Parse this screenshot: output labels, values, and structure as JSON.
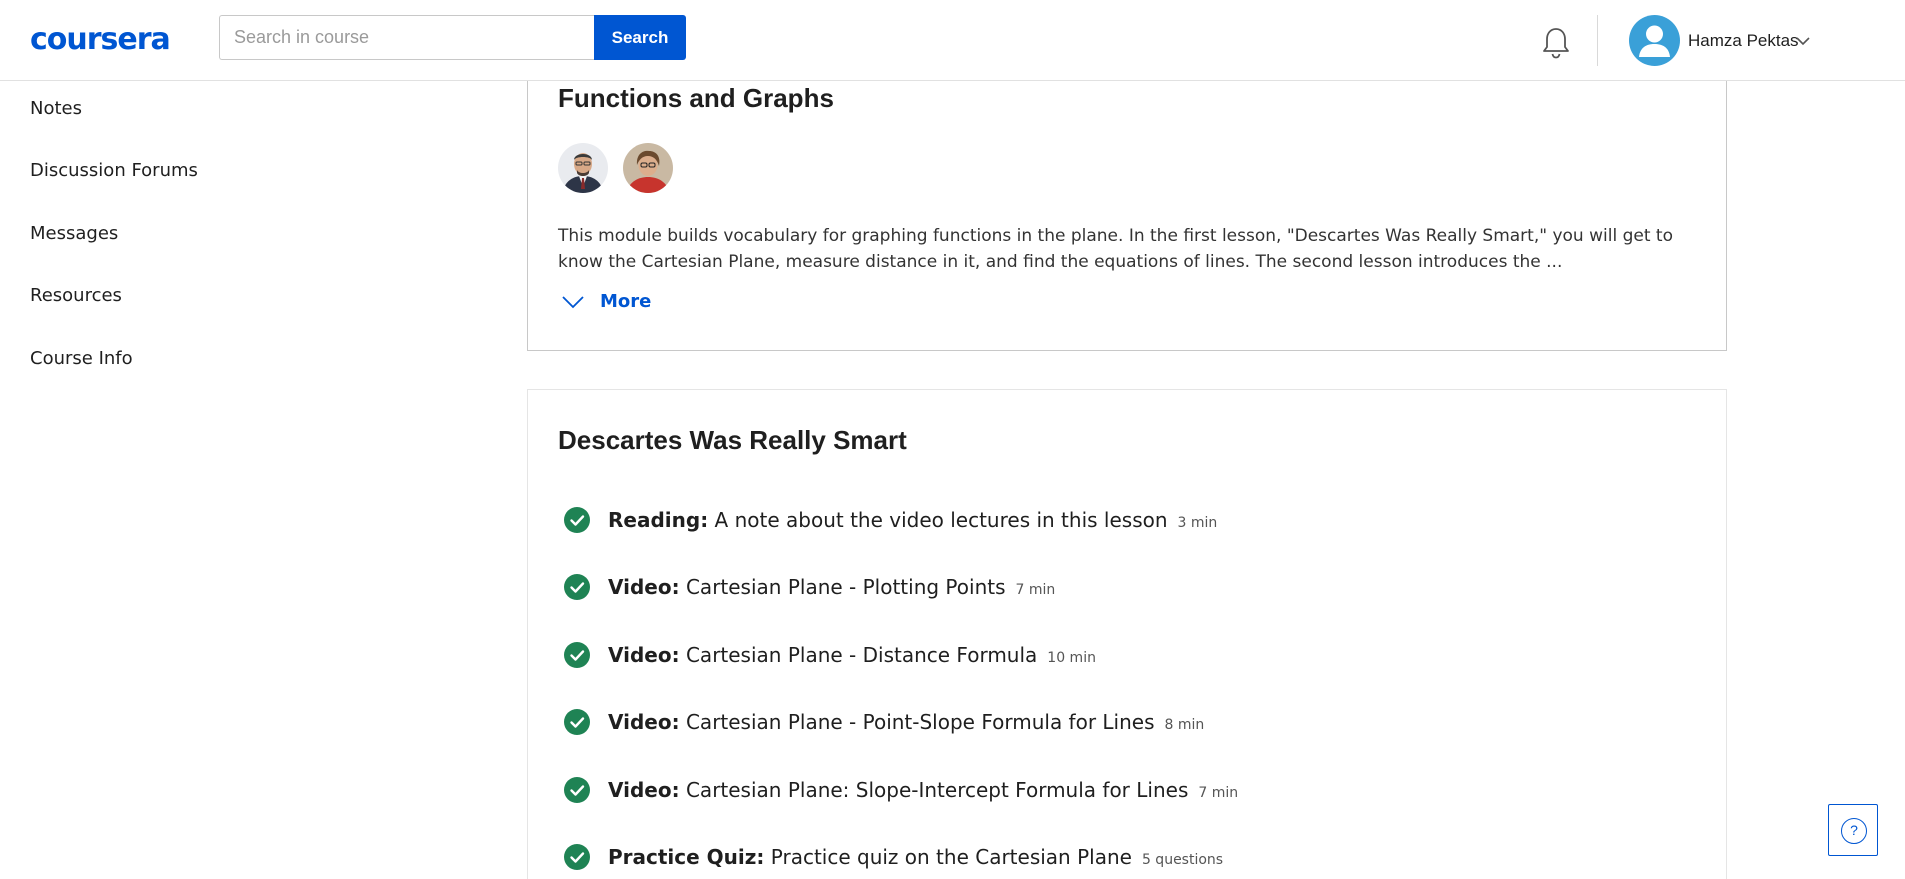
{
  "header": {
    "logo_text": "coursera",
    "search_placeholder": "Search in course",
    "search_button": "Search",
    "user_name": "Hamza Pektas",
    "brand_color": "#0056d2"
  },
  "sidebar": {
    "items": [
      {
        "label": "Notes"
      },
      {
        "label": "Discussion Forums"
      },
      {
        "label": "Messages"
      },
      {
        "label": "Resources"
      },
      {
        "label": "Course Info"
      }
    ]
  },
  "module": {
    "title": "Functions and Graphs",
    "description": "This module builds vocabulary for graphing functions in the plane. In the first lesson, \"Descartes Was Really Smart,\" you will get to know the Cartesian Plane, measure distance in it, and find the equations of lines. The second lesson introduces the ...",
    "more_label": "More"
  },
  "lesson": {
    "title": "Descartes Was Really Smart",
    "items": [
      {
        "type": "Reading:",
        "name": "A note about the video lectures in this lesson",
        "duration": "3 min",
        "completed": true
      },
      {
        "type": "Video:",
        "name": "Cartesian Plane - Plotting Points",
        "duration": "7 min",
        "completed": true
      },
      {
        "type": "Video:",
        "name": "Cartesian Plane - Distance Formula",
        "duration": "10 min",
        "completed": true
      },
      {
        "type": "Video:",
        "name": "Cartesian Plane - Point-Slope Formula for Lines",
        "duration": "8 min",
        "completed": true
      },
      {
        "type": "Video:",
        "name": "Cartesian Plane: Slope-Intercept Formula for Lines",
        "duration": "7 min",
        "completed": true
      },
      {
        "type": "Practice Quiz:",
        "name": "Practice quiz on the Cartesian Plane",
        "duration": "5 questions",
        "completed": true
      }
    ],
    "check_color": "#1f8354"
  },
  "help": {
    "glyph": "?"
  }
}
